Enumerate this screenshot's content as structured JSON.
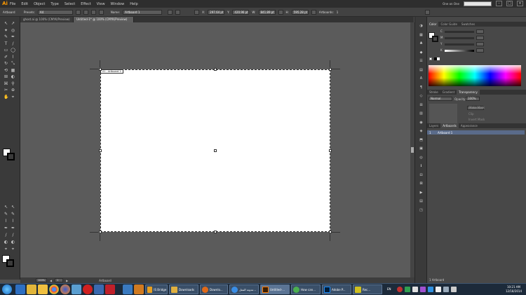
{
  "app": {
    "logo": "Ai"
  },
  "menu": [
    "File",
    "Edit",
    "Object",
    "Type",
    "Select",
    "Effect",
    "View",
    "Window",
    "Help"
  ],
  "workspace": "One on One",
  "control": {
    "mode": "Artboard",
    "preset_label": "Presets:",
    "preset_value": "A4",
    "name_label": "Name:",
    "name_value": "Artboard 1",
    "x_label": "X:",
    "x_value": "297.64 pt",
    "y_label": "Y:",
    "y_value": "420.96 pt",
    "w_label": "W:",
    "w_value": "841.89 pt",
    "h_label": "H:",
    "h_value": "595.28 pt",
    "artboards_label": "Artboards:",
    "artboards_value": "1"
  },
  "doc_tabs": [
    {
      "label": "ghost.ai @ 100% (CMYK/Preview)",
      "active": false
    },
    {
      "label": "Untitled-1* @ 100% (CMYK/Preview)",
      "active": true
    }
  ],
  "artboard": {
    "label": "01 - Artboard 1"
  },
  "status": {
    "zoom": "100%",
    "page": "1",
    "tool": "Artboard"
  },
  "color_panel": {
    "tabs": [
      "Color",
      "Color Guide",
      "Swatches"
    ],
    "channels": [
      "C",
      "M",
      "Y",
      "K"
    ]
  },
  "stroke_panel": {
    "tabs": [
      "Stroke",
      "Gradient",
      "Transparency"
    ],
    "blend_mode": "Normal",
    "opacity_label": "Opacity:",
    "opacity_value": "100%",
    "make_mask": "Make Mask",
    "clip": "Clip",
    "invert_mask": "Invert Mask"
  },
  "layers_panel": {
    "tabs": [
      "Layers",
      "Artboards",
      "Appearance"
    ],
    "rows": [
      {
        "index": "1",
        "label": "Artboard 1"
      }
    ],
    "footer": "1 Artboard"
  },
  "taskbar": {
    "items": [
      {
        "label": "IS Bridge ...",
        "color": "#e8a020"
      },
      {
        "label": "Downloads",
        "color": "#e0b040"
      },
      {
        "label": "Downlo...",
        "color": "#e06a1a"
      },
      {
        "label": "مدونة المعل...",
        "color": "#3a8ee6"
      },
      {
        "label": "Untitled-...",
        "color": "#ff7c00"
      },
      {
        "label": "How can...",
        "color": "#4caf50"
      },
      {
        "label": "Adobe P...",
        "color": "#1c5fd0"
      },
      {
        "label": "Rec...",
        "color": "#d0c020"
      }
    ],
    "lang": "EN",
    "time": "10:21 AM",
    "date": "12/18/2014"
  },
  "colors": {
    "accent": "#ff9a00",
    "selection": "#5a6b8a",
    "taskbar": "#1c2a3a"
  }
}
